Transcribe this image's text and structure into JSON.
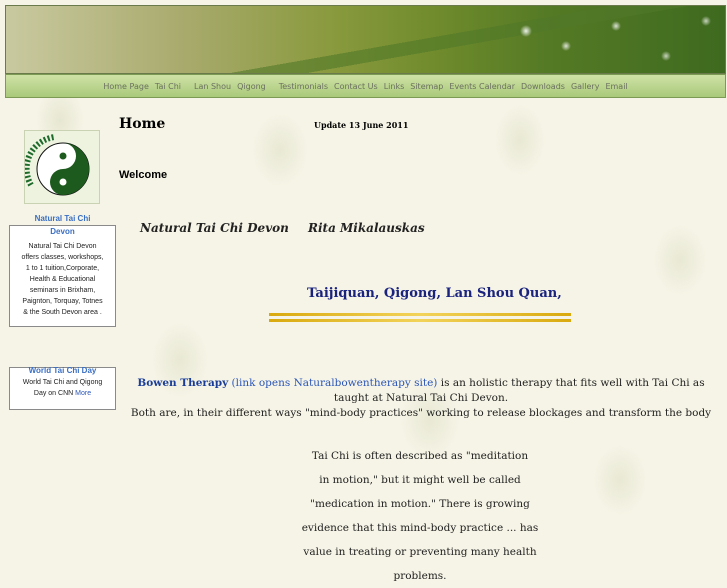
{
  "nav": {
    "items": [
      "Home Page",
      "Tai Chi",
      "Lan Shou",
      "Qigong",
      "Testimonials",
      "Contact Us",
      "Links",
      "Sitemap",
      "Events Calendar",
      "Downloads",
      "Gallery",
      "Email"
    ]
  },
  "logo": {
    "text": "natural tai chi devon"
  },
  "sidebar": {
    "ntcd_box": {
      "title_line1": "Natural Tai Chi",
      "title_line2": "Devon",
      "lines": [
        "Natural Tai Chi Devon",
        "offers classes, workshops,",
        "1 to 1 tuition,Corporate,",
        "Health & Educational",
        "seminars in Brixham,",
        "Paignton, Torquay, Totnes",
        "& the South Devon area ."
      ]
    },
    "wtcd_box": {
      "title": "World Tai Chi Day",
      "line1": "World Tai Chi and Qigong",
      "line2_prefix": "Day on CNN",
      "more": "More"
    }
  },
  "main": {
    "home_title": "Home",
    "update": "Update 13 June 2011",
    "welcome": "Welcome",
    "ntcd": "Natural Tai Chi Devon",
    "rita": "Rita Mikalauskas",
    "taiji": "Taijiquan, Qigong, Lan Shou Quan,",
    "bowen_link1": "Bowen Therapy",
    "bowen_link2": "(link opens Naturalbowentherapy site)",
    "bowen_rest": "is an holistic therapy that fits well with Tai Chi as taught at Natural Tai Chi Devon.",
    "both": "Both are, in their different ways \"mind-body practices\" working to release blockages and transform the body",
    "para_lines": [
      "Tai Chi is often described as \"meditation",
      "in motion,\" but it might well be called",
      "\"medication in motion.\" There is growing",
      "evidence that this mind-body practice ... has",
      "value in treating or preventing many health problems."
    ]
  },
  "colors": {
    "nav_bg": "#b9d48e",
    "link": "#2b56b8",
    "heading_blue": "#1a237e",
    "gold_rule": "#e3b62a"
  }
}
